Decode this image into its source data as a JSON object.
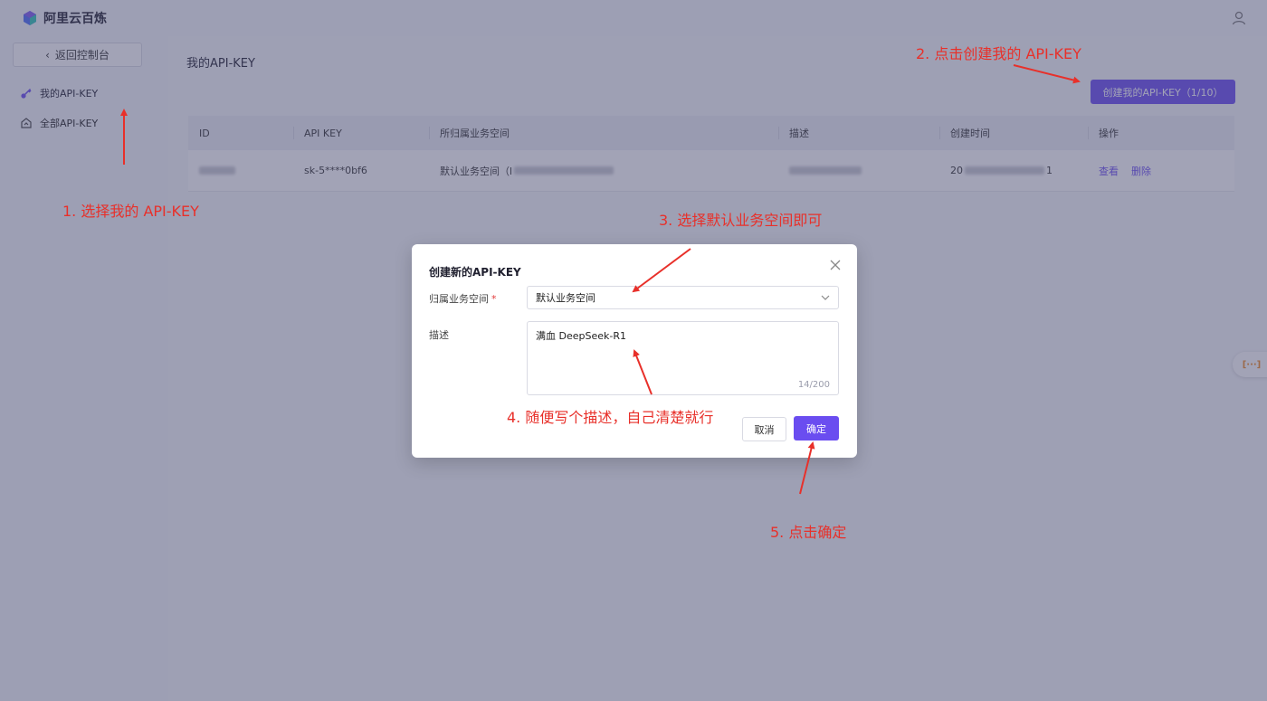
{
  "app": {
    "title": "阿里云百炼"
  },
  "sidebar": {
    "back_label": "返回控制台",
    "items": [
      {
        "label": "我的API-KEY",
        "icon": "key-icon",
        "active": true
      },
      {
        "label": "全部API-KEY",
        "icon": "house-icon",
        "active": false
      }
    ]
  },
  "main": {
    "title": "我的API-KEY",
    "create_button": "创建我的API-KEY（1/10）",
    "table": {
      "columns": [
        "ID",
        "API KEY",
        "所归属业务空间",
        "描述",
        "创建时间",
        "操作"
      ],
      "rows": [
        {
          "id": "",
          "api_key": "sk-5****0bf6",
          "workspace": "默认业务空间（l",
          "description": "",
          "created_prefix": "20",
          "created_suffix": "1",
          "action_view": "查看",
          "action_delete": "删除"
        }
      ]
    }
  },
  "modal": {
    "title": "创建新的API-KEY",
    "workspace_label": "归属业务空间",
    "required_mark": "*",
    "workspace_value": "默认业务空间",
    "description_label": "描述",
    "description_value": "满血 DeepSeek-R1",
    "counter": "14/200",
    "cancel_label": "取消",
    "ok_label": "确定"
  },
  "floating_widget": {
    "label": "[···]"
  },
  "annotations": {
    "step1": "1. 选择我的 API-KEY",
    "step2": "2. 点击创建我的 API-KEY",
    "step3": "3. 选择默认业务空间即可",
    "step4": "4. 随便写个描述，自己清楚就行",
    "step5": "5. 点击确定"
  },
  "colors": {
    "accent": "#6a4df0",
    "annotation": "#e8302a",
    "mask": "#46486e"
  }
}
